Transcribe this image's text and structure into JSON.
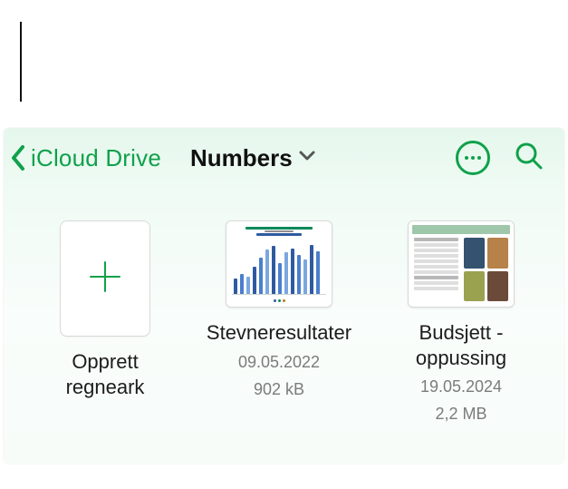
{
  "colors": {
    "accent": "#0fa14a"
  },
  "nav": {
    "back_label": "iCloud Drive",
    "title": "Numbers"
  },
  "icons": {
    "back": "chevron-left",
    "title_dropdown": "chevron-down",
    "more": "ellipsis-circle",
    "search": "magnifying-glass",
    "create": "plus"
  },
  "tiles": [
    {
      "kind": "create",
      "label": "Opprett regneark"
    },
    {
      "kind": "document",
      "label": "Stevneresultater",
      "date": "09.05.2022",
      "size": "902 kB",
      "preview": "bar-chart"
    },
    {
      "kind": "document",
      "label": "Budsjett - oppussing",
      "date": "19.05.2024",
      "size": "2,2 MB",
      "preview": "budget-sheet"
    }
  ]
}
